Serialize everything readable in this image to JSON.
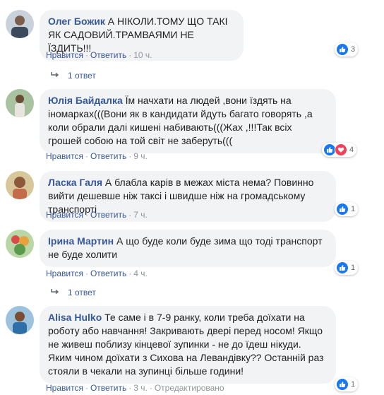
{
  "comments": [
    {
      "author": "Олег Божик",
      "text": "А НІКОЛИ.ТОМУ ЩО ТАКІ ЯК САДОВИЙ.ТРАМВАЯМИ НЕ ЇЗДИТЬ!!!",
      "like_label": "Нравится",
      "reply_label": "Ответить",
      "time": "10 ч.",
      "reaction_count": "3",
      "reactions": [
        "like"
      ],
      "replies_label": "1 ответ"
    },
    {
      "author": "Юлія Байдалка",
      "text": "Їм начхати на людей ,вони їздять на іномарках(((Вони як в кандидати йдуть багато говорять ,а коли обрали далі кишені набивають(((Жах ,!!!Так всіх грошей собою на той світ не заберуть(((",
      "like_label": "Нравится",
      "reply_label": "Ответить",
      "time": "9 ч.",
      "reaction_count": "4",
      "reactions": [
        "like",
        "love"
      ]
    },
    {
      "author": "Ласка Галя",
      "text": "А блабла карів в межах міста нема? Повинно вийти дешевше ніж таксі і швидше ніж на громадському транспорті",
      "like_label": "Нравится",
      "reply_label": "Ответить",
      "time": "7 ч.",
      "reaction_count": "1",
      "reactions": [
        "like"
      ]
    },
    {
      "author": "Ірина Мартин",
      "text": "А що буде коли буде зима що тоді транспорт не буде холити",
      "like_label": "Нравится",
      "reply_label": "Ответить",
      "time": "4 ч.",
      "reaction_count": "1",
      "reactions": [
        "like"
      ],
      "replies_label": "1 ответ"
    },
    {
      "author": "Alisa Hulko",
      "text": "Те саме і в 7-9 ранку, коли треба доїхати на роботу або навчання! Закривають двері перед носом! Якщо не живеш поблизу кінцевої зупинки - не до їдеш нікуди. Яким чином доїхати з Сихова на Левандівку?? Останній раз стояли в чекали на зупинці більше години!",
      "like_label": "Нравится",
      "reply_label": "Ответить",
      "time": "3 ч.",
      "edited_label": "Отредактировано",
      "reaction_count": "1",
      "reactions": [
        "like"
      ]
    }
  ],
  "colors": {
    "author": "#385898",
    "bubble": "#f2f3f5",
    "like": "#1877f2",
    "love": "#f33e58"
  },
  "icons": {
    "like": "thumbs-up-icon",
    "love": "heart-icon",
    "reply_arrow": "reply-arrow-icon"
  }
}
